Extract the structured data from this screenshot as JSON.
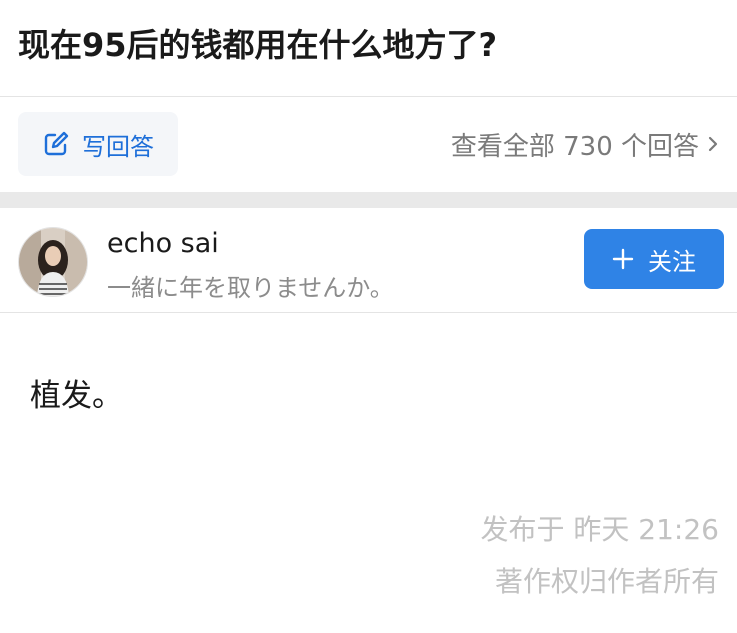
{
  "question": {
    "title": "现在95后的钱都用在什么地方了?"
  },
  "actions": {
    "write_answer_label": "写回答",
    "view_all_label": "查看全部 730 个回答"
  },
  "author": {
    "name": "echo sai",
    "bio": "一緒に年を取りませんか。",
    "follow_label": "关注"
  },
  "answer": {
    "content": "植发。",
    "publish_time": "发布于 昨天 21:26",
    "copyright": "著作权归作者所有"
  },
  "colors": {
    "accent": "#2f83e6",
    "accent_text": "#1e6fd9",
    "muted_text": "#8c8c8c",
    "faint_text": "#c2c2c2"
  },
  "icons": {
    "write": "edit-icon",
    "chevron": "chevron-right-icon",
    "follow": "plus-icon"
  }
}
